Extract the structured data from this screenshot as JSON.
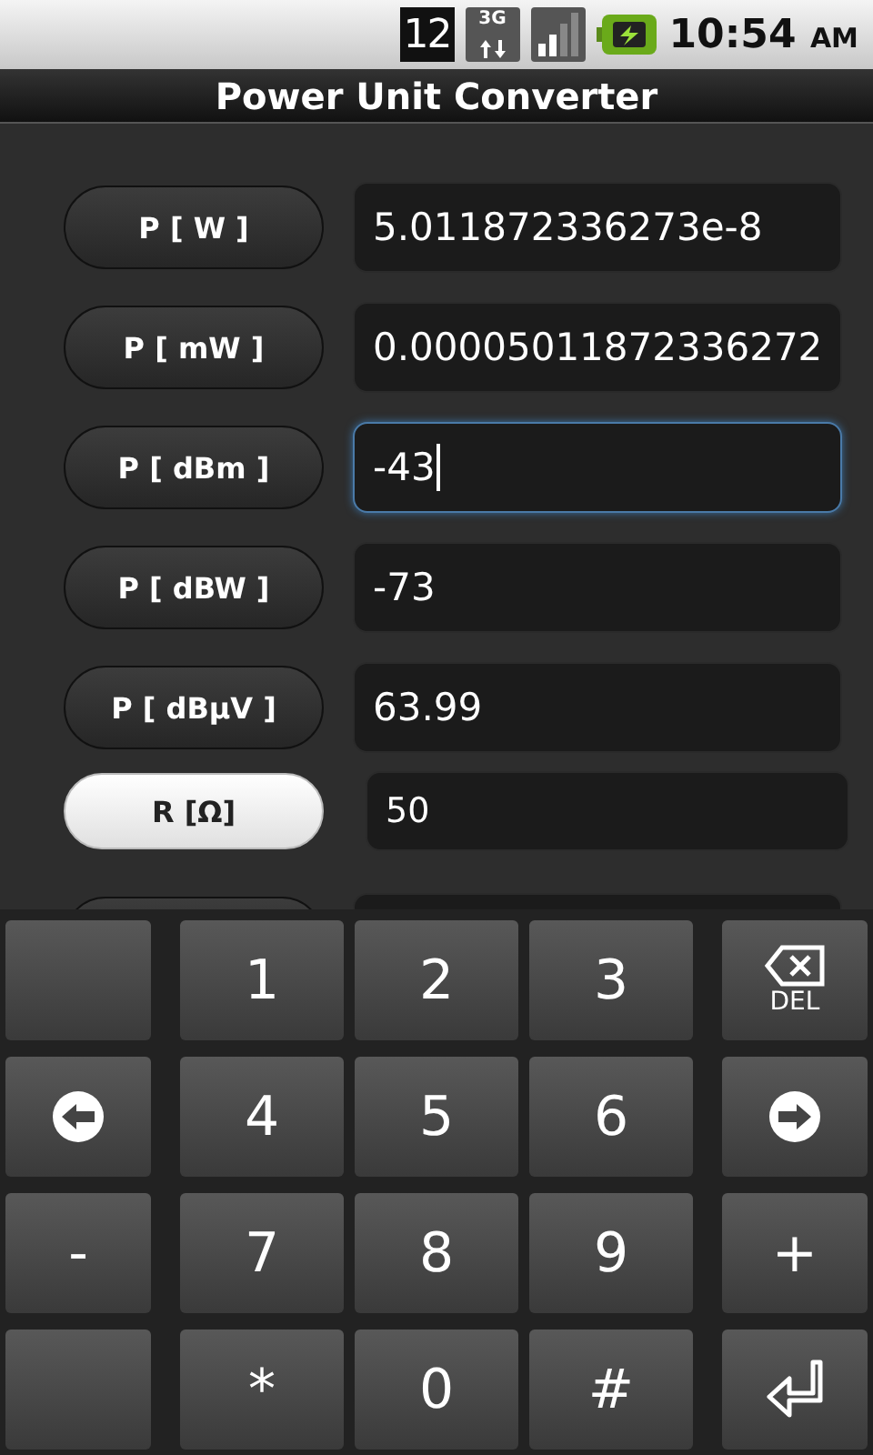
{
  "status_bar": {
    "notification_count": "12",
    "network": "3G",
    "time": "10:54",
    "time_suffix": "AM"
  },
  "title": "Power Unit Converter",
  "rows": [
    {
      "kind": "power",
      "label": "P [ W ]",
      "value": "5.011872336273e-8",
      "focused": false
    },
    {
      "kind": "power",
      "label": "P [ mW ]",
      "value": "0.00005011872336272",
      "focused": false
    },
    {
      "kind": "power",
      "label": "P [ dBm ]",
      "value": "-43",
      "focused": true
    },
    {
      "kind": "power",
      "label": "P [ dBW ]",
      "value": "-73",
      "focused": false
    },
    {
      "kind": "power",
      "label": "P [ dBµV ]",
      "value": "63.99",
      "focused": false
    },
    {
      "kind": "resistance",
      "label": "R [Ω]",
      "value": "50",
      "focused": false
    },
    {
      "kind": "cut"
    }
  ],
  "keyboard": [
    {
      "kind": "blank"
    },
    {
      "kind": "text",
      "label": "1"
    },
    {
      "kind": "text",
      "label": "2"
    },
    {
      "kind": "text",
      "label": "3"
    },
    {
      "kind": "del",
      "label": "DEL"
    },
    {
      "kind": "left"
    },
    {
      "kind": "text",
      "label": "4"
    },
    {
      "kind": "text",
      "label": "5"
    },
    {
      "kind": "text",
      "label": "6"
    },
    {
      "kind": "right"
    },
    {
      "kind": "text",
      "label": "-"
    },
    {
      "kind": "text",
      "label": "7"
    },
    {
      "kind": "text",
      "label": "8"
    },
    {
      "kind": "text",
      "label": "9"
    },
    {
      "kind": "text",
      "label": "+"
    },
    {
      "kind": "blank"
    },
    {
      "kind": "text",
      "label": "*"
    },
    {
      "kind": "text",
      "label": "0"
    },
    {
      "kind": "text",
      "label": "#"
    },
    {
      "kind": "enter"
    }
  ]
}
